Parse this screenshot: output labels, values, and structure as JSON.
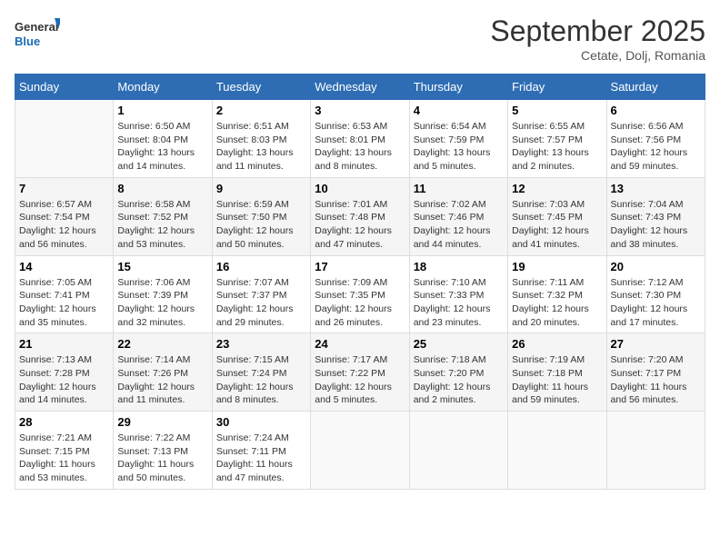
{
  "logo": {
    "line1": "General",
    "line2": "Blue"
  },
  "title": "September 2025",
  "subtitle": "Cetate, Dolj, Romania",
  "days_of_week": [
    "Sunday",
    "Monday",
    "Tuesday",
    "Wednesday",
    "Thursday",
    "Friday",
    "Saturday"
  ],
  "weeks": [
    [
      {
        "day": "",
        "sunrise": "",
        "sunset": "",
        "daylight": ""
      },
      {
        "day": "1",
        "sunrise": "Sunrise: 6:50 AM",
        "sunset": "Sunset: 8:04 PM",
        "daylight": "Daylight: 13 hours and 14 minutes."
      },
      {
        "day": "2",
        "sunrise": "Sunrise: 6:51 AM",
        "sunset": "Sunset: 8:03 PM",
        "daylight": "Daylight: 13 hours and 11 minutes."
      },
      {
        "day": "3",
        "sunrise": "Sunrise: 6:53 AM",
        "sunset": "Sunset: 8:01 PM",
        "daylight": "Daylight: 13 hours and 8 minutes."
      },
      {
        "day": "4",
        "sunrise": "Sunrise: 6:54 AM",
        "sunset": "Sunset: 7:59 PM",
        "daylight": "Daylight: 13 hours and 5 minutes."
      },
      {
        "day": "5",
        "sunrise": "Sunrise: 6:55 AM",
        "sunset": "Sunset: 7:57 PM",
        "daylight": "Daylight: 13 hours and 2 minutes."
      },
      {
        "day": "6",
        "sunrise": "Sunrise: 6:56 AM",
        "sunset": "Sunset: 7:56 PM",
        "daylight": "Daylight: 12 hours and 59 minutes."
      }
    ],
    [
      {
        "day": "7",
        "sunrise": "Sunrise: 6:57 AM",
        "sunset": "Sunset: 7:54 PM",
        "daylight": "Daylight: 12 hours and 56 minutes."
      },
      {
        "day": "8",
        "sunrise": "Sunrise: 6:58 AM",
        "sunset": "Sunset: 7:52 PM",
        "daylight": "Daylight: 12 hours and 53 minutes."
      },
      {
        "day": "9",
        "sunrise": "Sunrise: 6:59 AM",
        "sunset": "Sunset: 7:50 PM",
        "daylight": "Daylight: 12 hours and 50 minutes."
      },
      {
        "day": "10",
        "sunrise": "Sunrise: 7:01 AM",
        "sunset": "Sunset: 7:48 PM",
        "daylight": "Daylight: 12 hours and 47 minutes."
      },
      {
        "day": "11",
        "sunrise": "Sunrise: 7:02 AM",
        "sunset": "Sunset: 7:46 PM",
        "daylight": "Daylight: 12 hours and 44 minutes."
      },
      {
        "day": "12",
        "sunrise": "Sunrise: 7:03 AM",
        "sunset": "Sunset: 7:45 PM",
        "daylight": "Daylight: 12 hours and 41 minutes."
      },
      {
        "day": "13",
        "sunrise": "Sunrise: 7:04 AM",
        "sunset": "Sunset: 7:43 PM",
        "daylight": "Daylight: 12 hours and 38 minutes."
      }
    ],
    [
      {
        "day": "14",
        "sunrise": "Sunrise: 7:05 AM",
        "sunset": "Sunset: 7:41 PM",
        "daylight": "Daylight: 12 hours and 35 minutes."
      },
      {
        "day": "15",
        "sunrise": "Sunrise: 7:06 AM",
        "sunset": "Sunset: 7:39 PM",
        "daylight": "Daylight: 12 hours and 32 minutes."
      },
      {
        "day": "16",
        "sunrise": "Sunrise: 7:07 AM",
        "sunset": "Sunset: 7:37 PM",
        "daylight": "Daylight: 12 hours and 29 minutes."
      },
      {
        "day": "17",
        "sunrise": "Sunrise: 7:09 AM",
        "sunset": "Sunset: 7:35 PM",
        "daylight": "Daylight: 12 hours and 26 minutes."
      },
      {
        "day": "18",
        "sunrise": "Sunrise: 7:10 AM",
        "sunset": "Sunset: 7:33 PM",
        "daylight": "Daylight: 12 hours and 23 minutes."
      },
      {
        "day": "19",
        "sunrise": "Sunrise: 7:11 AM",
        "sunset": "Sunset: 7:32 PM",
        "daylight": "Daylight: 12 hours and 20 minutes."
      },
      {
        "day": "20",
        "sunrise": "Sunrise: 7:12 AM",
        "sunset": "Sunset: 7:30 PM",
        "daylight": "Daylight: 12 hours and 17 minutes."
      }
    ],
    [
      {
        "day": "21",
        "sunrise": "Sunrise: 7:13 AM",
        "sunset": "Sunset: 7:28 PM",
        "daylight": "Daylight: 12 hours and 14 minutes."
      },
      {
        "day": "22",
        "sunrise": "Sunrise: 7:14 AM",
        "sunset": "Sunset: 7:26 PM",
        "daylight": "Daylight: 12 hours and 11 minutes."
      },
      {
        "day": "23",
        "sunrise": "Sunrise: 7:15 AM",
        "sunset": "Sunset: 7:24 PM",
        "daylight": "Daylight: 12 hours and 8 minutes."
      },
      {
        "day": "24",
        "sunrise": "Sunrise: 7:17 AM",
        "sunset": "Sunset: 7:22 PM",
        "daylight": "Daylight: 12 hours and 5 minutes."
      },
      {
        "day": "25",
        "sunrise": "Sunrise: 7:18 AM",
        "sunset": "Sunset: 7:20 PM",
        "daylight": "Daylight: 12 hours and 2 minutes."
      },
      {
        "day": "26",
        "sunrise": "Sunrise: 7:19 AM",
        "sunset": "Sunset: 7:18 PM",
        "daylight": "Daylight: 11 hours and 59 minutes."
      },
      {
        "day": "27",
        "sunrise": "Sunrise: 7:20 AM",
        "sunset": "Sunset: 7:17 PM",
        "daylight": "Daylight: 11 hours and 56 minutes."
      }
    ],
    [
      {
        "day": "28",
        "sunrise": "Sunrise: 7:21 AM",
        "sunset": "Sunset: 7:15 PM",
        "daylight": "Daylight: 11 hours and 53 minutes."
      },
      {
        "day": "29",
        "sunrise": "Sunrise: 7:22 AM",
        "sunset": "Sunset: 7:13 PM",
        "daylight": "Daylight: 11 hours and 50 minutes."
      },
      {
        "day": "30",
        "sunrise": "Sunrise: 7:24 AM",
        "sunset": "Sunset: 7:11 PM",
        "daylight": "Daylight: 11 hours and 47 minutes."
      },
      {
        "day": "",
        "sunrise": "",
        "sunset": "",
        "daylight": ""
      },
      {
        "day": "",
        "sunrise": "",
        "sunset": "",
        "daylight": ""
      },
      {
        "day": "",
        "sunrise": "",
        "sunset": "",
        "daylight": ""
      },
      {
        "day": "",
        "sunrise": "",
        "sunset": "",
        "daylight": ""
      }
    ]
  ]
}
